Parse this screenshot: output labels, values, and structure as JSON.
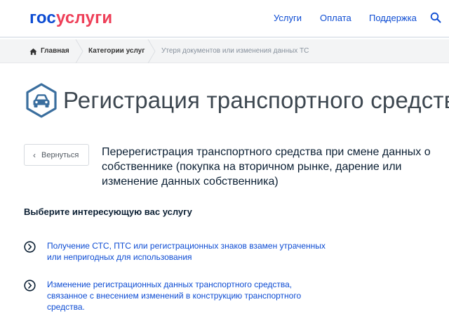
{
  "header": {
    "logo_part_a": "гос",
    "logo_part_b": "услуги",
    "nav": [
      {
        "label": "Услуги"
      },
      {
        "label": "Оплата"
      },
      {
        "label": "Поддержка"
      }
    ],
    "search_icon": "search-icon"
  },
  "breadcrumb": {
    "home": "Главная",
    "category": "Категории услуг",
    "current": "Утеря документов или изменения данных ТС"
  },
  "title": "Регистрация транспортного средства",
  "back_label": "Вернуться",
  "subtitle": "Перерегистрация транспортного средства при смене данных о собственнике (покупка на вторичном рынке, дарение или изменение данных собственника)",
  "section_heading": "Выберите интересующую вас услугу",
  "services": [
    {
      "label": "Получение СТС, ПТС или регистрационных знаков взамен утраченных или непригодных для использования"
    },
    {
      "label": "Изменение регистрационных данных транспортного средства, связанное с внесением изменений в конструкцию транспортного средства."
    }
  ],
  "colors": {
    "brand_blue": "#0d4cd3",
    "brand_red": "#ee3f58",
    "title_gray": "#3d4750",
    "badge_blue": "#3a6e9e"
  }
}
